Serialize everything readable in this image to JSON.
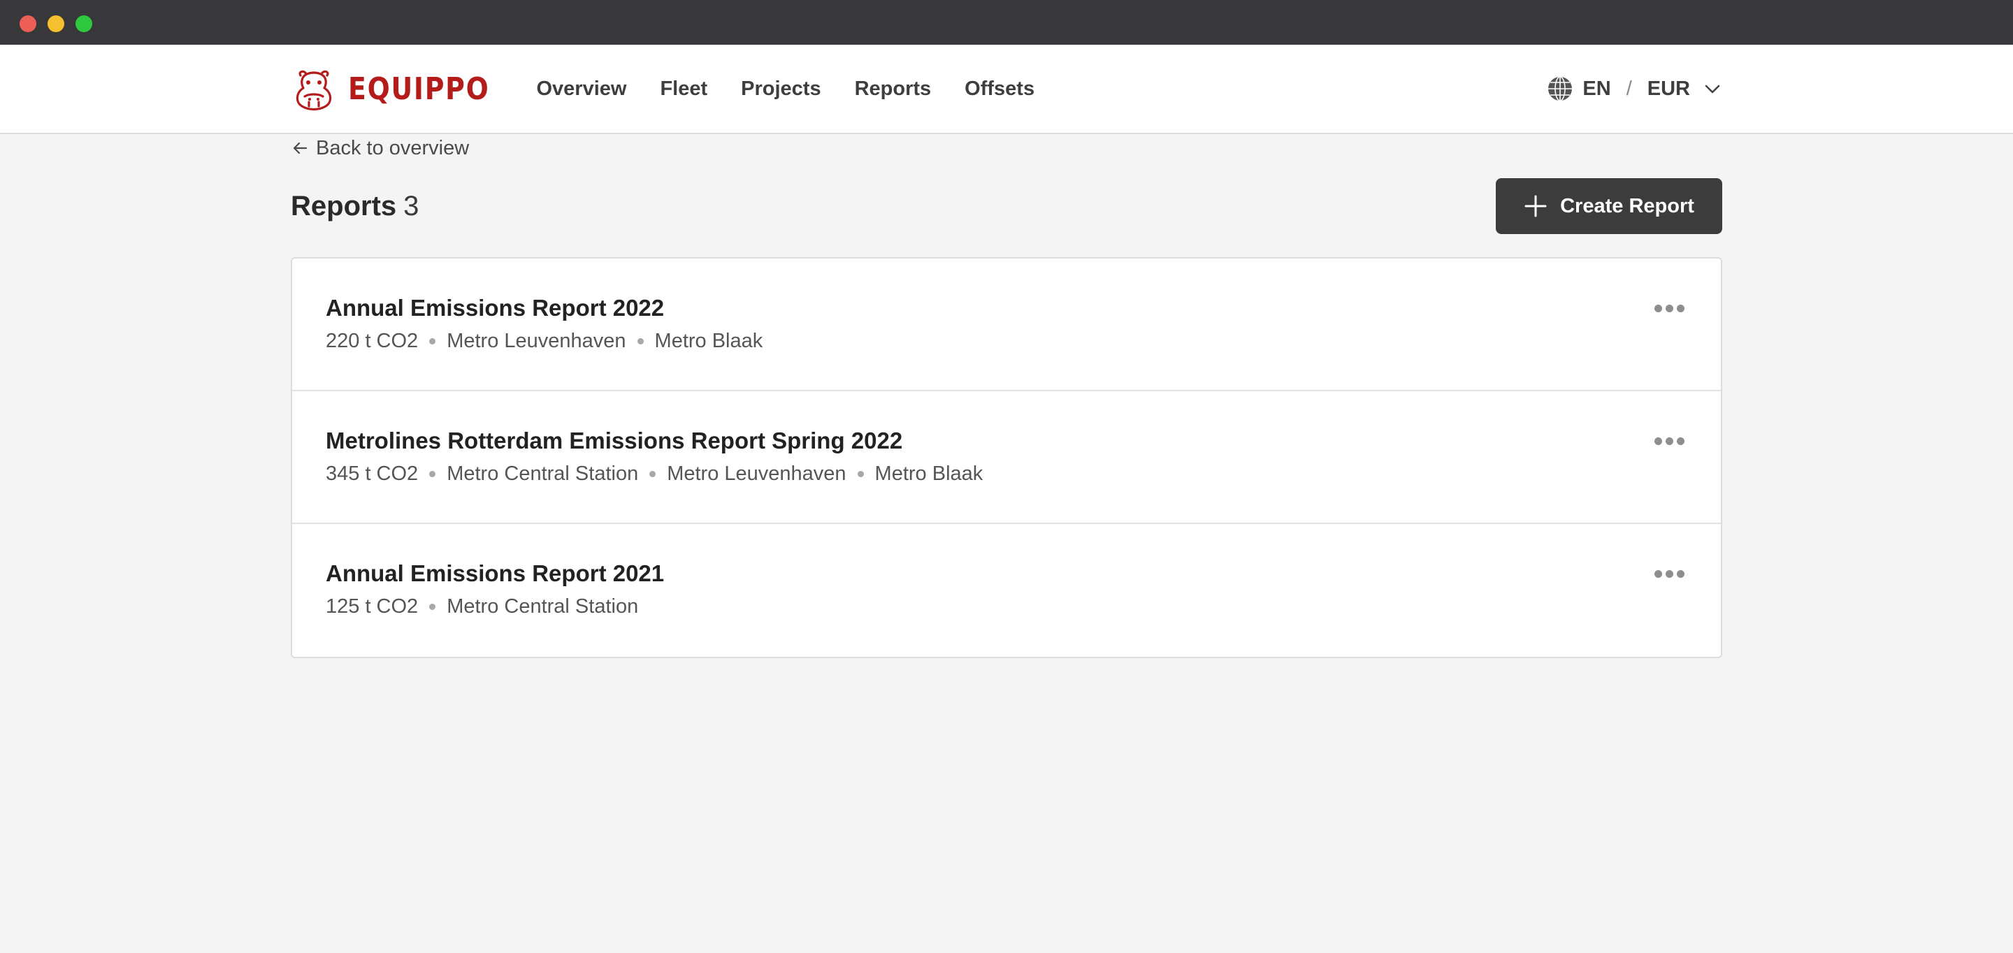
{
  "window": {},
  "brand": {
    "name": "EQUIPPO",
    "color": "#b41c1c"
  },
  "nav": {
    "links": [
      "Overview",
      "Fleet",
      "Projects",
      "Reports",
      "Offsets"
    ],
    "language": "EN",
    "currency": "EUR"
  },
  "page": {
    "back_label": "Back to overview",
    "title": "Reports",
    "count": "3",
    "create_label": "Create Report"
  },
  "reports": [
    {
      "title": "Annual Emissions Report 2022",
      "emissions": "220 t CO2",
      "locations": [
        "Metro Leuvenhaven",
        "Metro Blaak"
      ]
    },
    {
      "title": "Metrolines Rotterdam Emissions Report Spring 2022",
      "emissions": "345 t CO2",
      "locations": [
        "Metro Central Station",
        "Metro Leuvenhaven",
        "Metro Blaak"
      ]
    },
    {
      "title": "Annual Emissions Report 2021",
      "emissions": "125 t CO2",
      "locations": [
        "Metro Central Station"
      ]
    }
  ]
}
